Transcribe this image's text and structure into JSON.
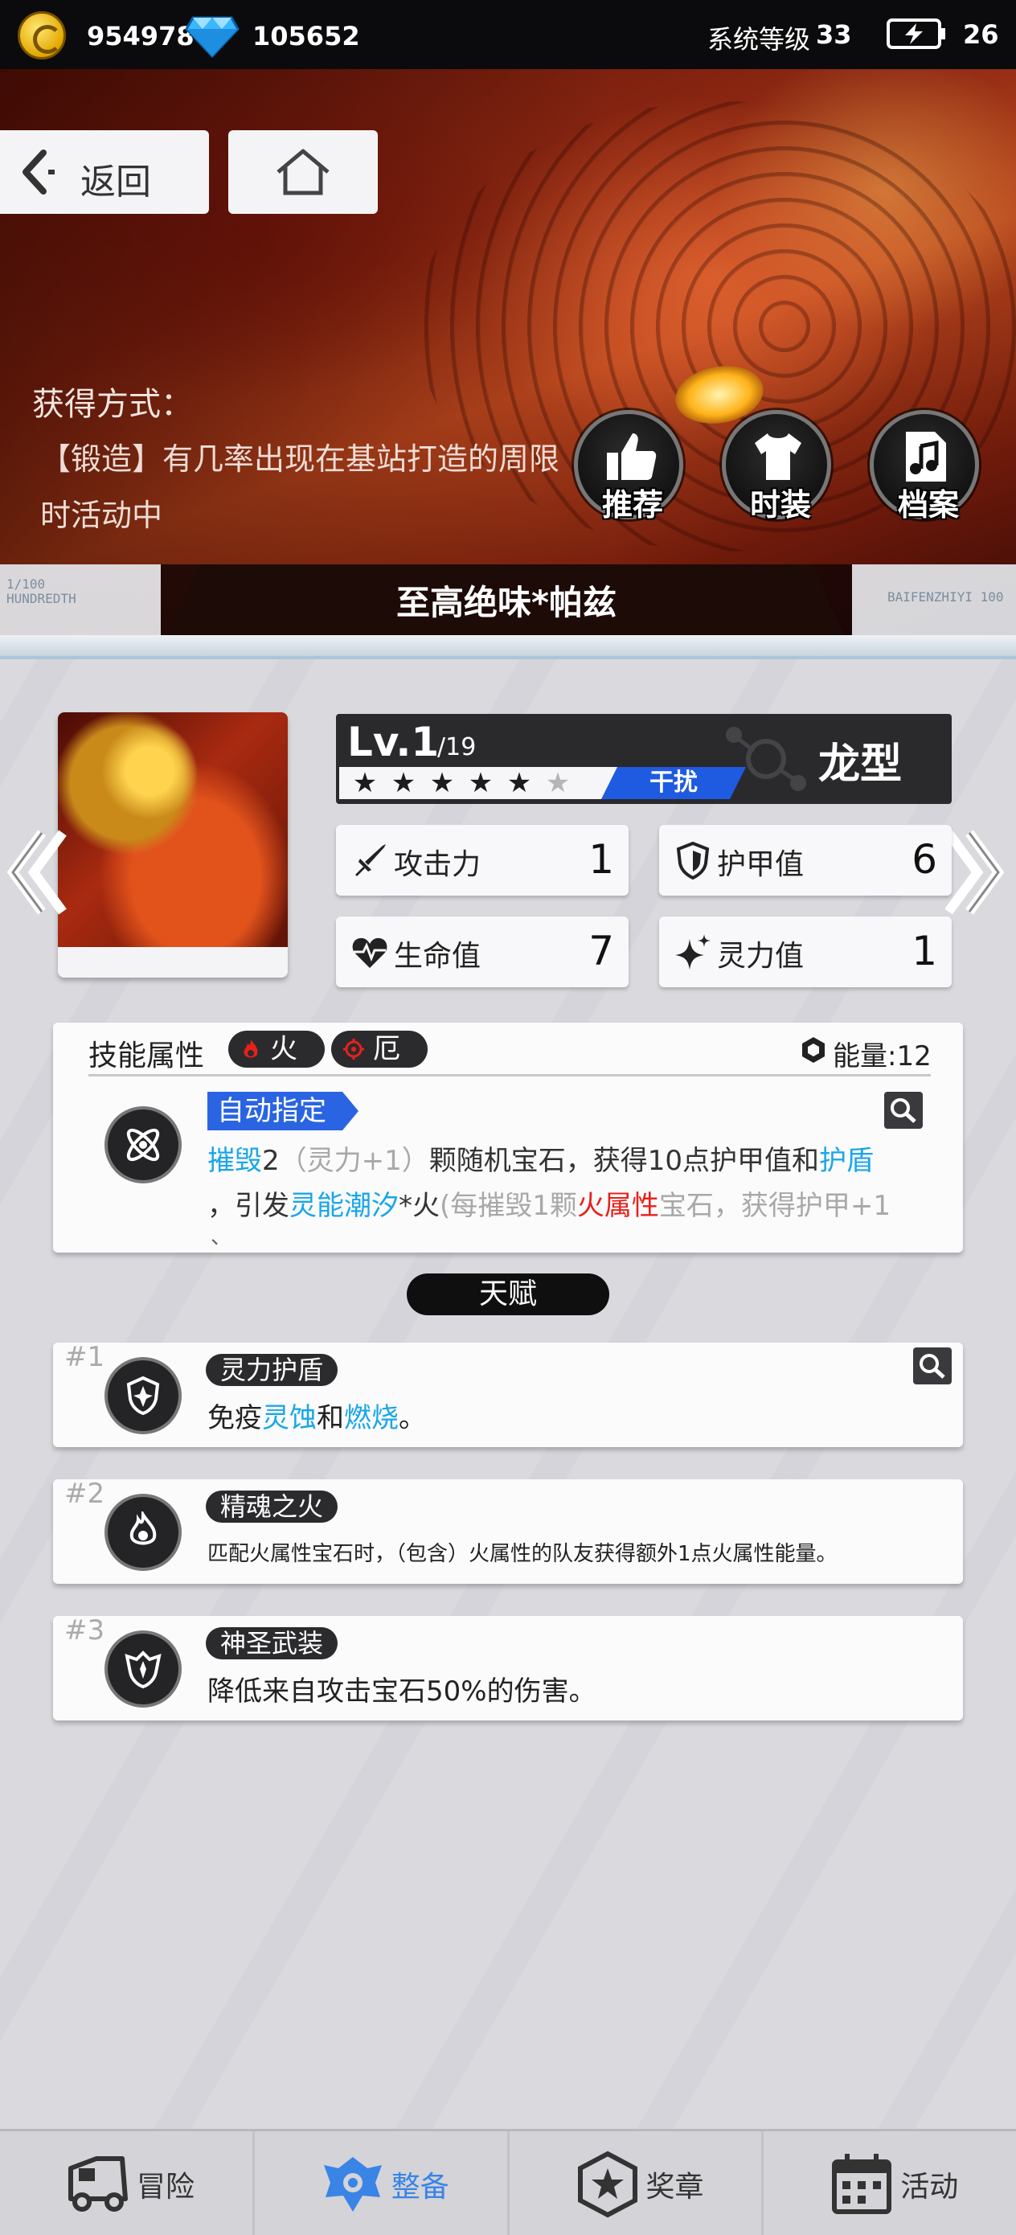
{
  "status_bar": {
    "gold": "954978",
    "diamonds": "105652",
    "system_level_label": "系统等级",
    "system_level_value": "33",
    "energy": "26",
    "icons": [
      "coin-icon",
      "diamond-icon",
      "energy-battery-icon"
    ]
  },
  "header": {
    "back_label": "返回",
    "home_icon": "home-icon"
  },
  "hero": {
    "obtain_title": "获得方式：",
    "obtain_desc": "【锻造】有几率出现在基站打造的周限时活动中",
    "buttons": [
      {
        "label": "推荐",
        "icon": "thumbs-up-icon"
      },
      {
        "label": "时装",
        "icon": "shirt-icon"
      },
      {
        "label": "档案",
        "icon": "music-file-icon"
      }
    ],
    "character_name": "至高绝味*帕兹",
    "deco_left": "1/100\nHUNDREDTH",
    "deco_right": "BAIFENZHIYI 100"
  },
  "character": {
    "level_label": "Lv.1",
    "level_max": "/19",
    "stars_filled": 5,
    "stars_total": 6,
    "role": "干扰",
    "type": "龙型",
    "stats": [
      {
        "label": "攻击力",
        "value": "1",
        "icon": "sword-icon"
      },
      {
        "label": "护甲值",
        "value": "6",
        "icon": "shield-icon"
      },
      {
        "label": "生命值",
        "value": "7",
        "icon": "heart-pulse-icon"
      },
      {
        "label": "灵力值",
        "value": "1",
        "icon": "sparkle-icon"
      }
    ]
  },
  "skill": {
    "attr_label": "技能属性",
    "elements": [
      {
        "label": "火",
        "icon": "fire-icon",
        "color": "#e8201a"
      },
      {
        "label": "厄",
        "icon": "curse-icon",
        "color": "#e8201a"
      }
    ],
    "energy_text": "能量:12",
    "targeting": "自动指定",
    "desc_line1": {
      "k1": "摧毁",
      "t1": "2",
      "g1": "（灵力+1）",
      "t2": "颗随机宝石，获得10点护甲值和",
      "k2": "护盾"
    },
    "desc_line2": {
      "t1": "，引发",
      "k1": "灵能潮汐",
      "t2": "*火",
      "g1": "(每摧毁1颗",
      "r1": "火属性",
      "g2": "宝石，获得护甲+1"
    },
    "desc_line3": "、"
  },
  "talents": {
    "header": "天赋",
    "items": [
      {
        "num": "#1",
        "name": "灵力护盾",
        "icon": "shield-spark-icon",
        "desc": {
          "t1": "免疫",
          "k1": "灵蚀",
          "t2": "和",
          "k2": "燃烧",
          "t3": "。"
        }
      },
      {
        "num": "#2",
        "name": "精魂之火",
        "icon": "spirit-flame-icon",
        "desc_text": "匹配火属性宝石时，（包含）火属性的队友获得额外1点火属性能量。"
      },
      {
        "num": "#3",
        "name": "神圣武装",
        "icon": "holy-armor-icon",
        "desc_text": "降低来自攻击宝石50%的伤害。"
      }
    ]
  },
  "nav": {
    "items": [
      {
        "label": "冒险",
        "icon": "vehicle-icon",
        "active": false
      },
      {
        "label": "整备",
        "icon": "gear-armor-icon",
        "active": true
      },
      {
        "label": "奖章",
        "icon": "medal-star-icon",
        "active": false
      },
      {
        "label": "活动",
        "icon": "calendar-icon",
        "active": false
      }
    ],
    "active_color": "#3a84e6"
  }
}
